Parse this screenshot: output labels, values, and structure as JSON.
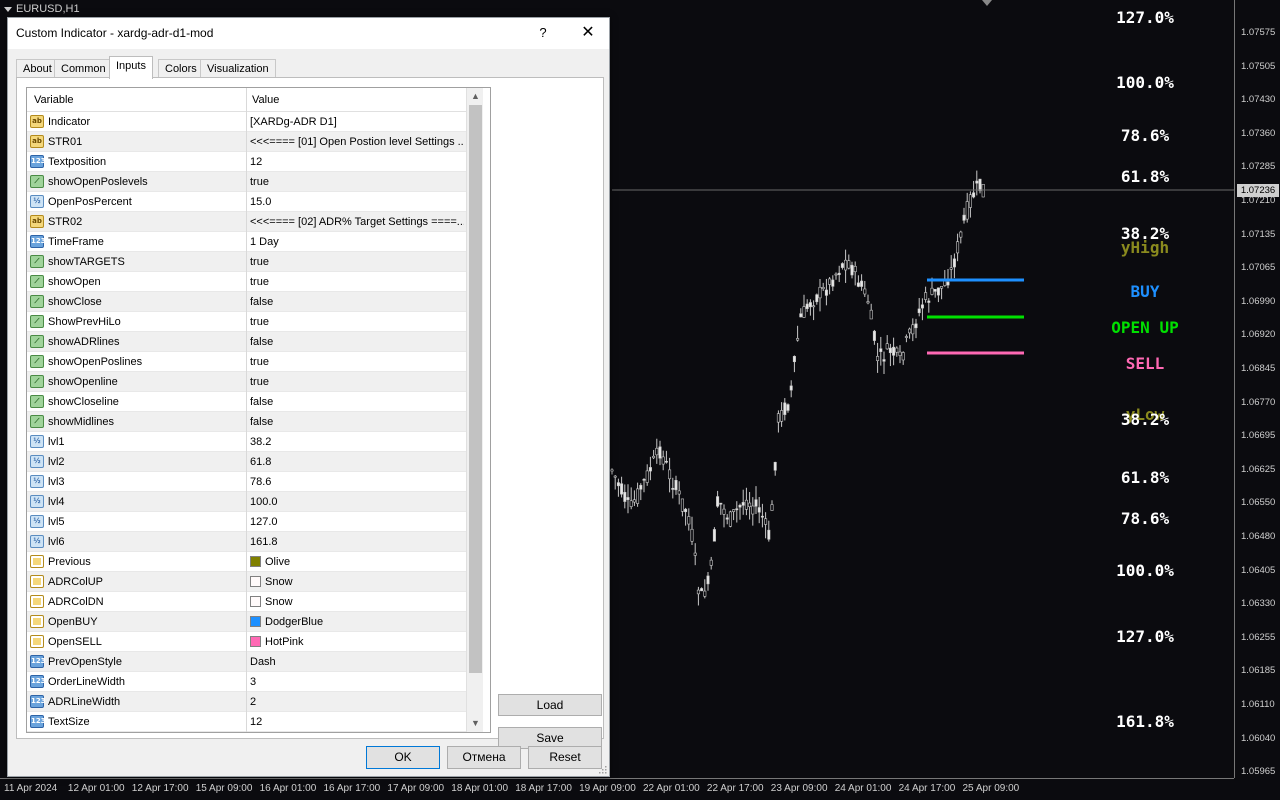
{
  "chart": {
    "symbol": "EURUSD,H1",
    "current_price": "1.07236",
    "price_ticks": [
      "1.07575",
      "1.07505",
      "1.07430",
      "1.07360",
      "1.07285",
      "1.07210",
      "1.07135",
      "1.07065",
      "1.06990",
      "1.06920",
      "1.06845",
      "1.06770",
      "1.06695",
      "1.06625",
      "1.06550",
      "1.06480",
      "1.06405",
      "1.06330",
      "1.06255",
      "1.06185",
      "1.06110",
      "1.06040",
      "1.05965"
    ],
    "time_ticks": [
      "11 Apr 2024",
      "12 Apr 01:00",
      "12 Apr 17:00",
      "15 Apr 09:00",
      "16 Apr 01:00",
      "16 Apr 17:00",
      "17 Apr 09:00",
      "18 Apr 01:00",
      "18 Apr 17:00",
      "19 Apr 09:00",
      "22 Apr 01:00",
      "22 Apr 17:00",
      "23 Apr 09:00",
      "24 Apr 01:00",
      "24 Apr 17:00",
      "25 Apr 09:00"
    ],
    "level_labels": [
      {
        "text": "127.0%",
        "color": "#ffffff"
      },
      {
        "text": "100.0%",
        "color": "#ffffff"
      },
      {
        "text": "78.6%",
        "color": "#ffffff"
      },
      {
        "text": "61.8%",
        "color": "#ffffff"
      },
      {
        "text": "38.2%",
        "color": "#ffffff"
      },
      {
        "text": "yHigh",
        "color": "#8a8a1e"
      },
      {
        "text": "BUY",
        "color": "#1e90ff"
      },
      {
        "text": "OPEN UP",
        "color": "#00e000"
      },
      {
        "text": "SELL",
        "color": "#ff69b4"
      },
      {
        "text": "yLow",
        "color": "#8a8a1e"
      },
      {
        "text": "38.2%",
        "color": "#ffffff"
      },
      {
        "text": "61.8%",
        "color": "#ffffff"
      },
      {
        "text": "78.6%",
        "color": "#ffffff"
      },
      {
        "text": "100.0%",
        "color": "#ffffff"
      },
      {
        "text": "127.0%",
        "color": "#ffffff"
      },
      {
        "text": "161.8%",
        "color": "#ffffff"
      }
    ],
    "colors": {
      "buy": "#1e90ff",
      "open": "#00e000",
      "sell": "#ff69b4",
      "candle": "#c8c8c8"
    }
  },
  "dialog": {
    "title": "Custom Indicator - xardg-adr-d1-mod",
    "help": "?",
    "close": "✕",
    "tabs": [
      "About",
      "Common",
      "Inputs",
      "Colors",
      "Visualization"
    ],
    "active_tab": "Inputs",
    "grid_headers": {
      "variable": "Variable",
      "value": "Value"
    },
    "rows": [
      {
        "icon": "ab",
        "var": "Indicator",
        "val": "[XARDg-ADR D1]"
      },
      {
        "icon": "ab",
        "var": "STR01",
        "val": "<<<==== [01] Open Postion level Settings ..."
      },
      {
        "icon": "n123",
        "var": "Textposition",
        "val": "12"
      },
      {
        "icon": "bool",
        "var": "showOpenPoslevels",
        "val": "true"
      },
      {
        "icon": "frac",
        "var": "OpenPosPercent",
        "val": "15.0"
      },
      {
        "icon": "ab",
        "var": "STR02",
        "val": "<<<==== [02] ADR% Target Settings ====..."
      },
      {
        "icon": "n123",
        "var": "TimeFrame",
        "val": "1 Day"
      },
      {
        "icon": "bool",
        "var": "showTARGETS",
        "val": "true"
      },
      {
        "icon": "bool",
        "var": "showOpen",
        "val": "true"
      },
      {
        "icon": "bool",
        "var": "showClose",
        "val": "false"
      },
      {
        "icon": "bool",
        "var": "ShowPrevHiLo",
        "val": "true"
      },
      {
        "icon": "bool",
        "var": "showADRlines",
        "val": "false"
      },
      {
        "icon": "bool",
        "var": "showOpenPoslines",
        "val": "true"
      },
      {
        "icon": "bool",
        "var": "showOpenline",
        "val": "true"
      },
      {
        "icon": "bool",
        "var": "showCloseline",
        "val": "false"
      },
      {
        "icon": "bool",
        "var": "showMidlines",
        "val": "false"
      },
      {
        "icon": "frac",
        "var": "lvl1",
        "val": "38.2"
      },
      {
        "icon": "frac",
        "var": "lvl2",
        "val": "61.8"
      },
      {
        "icon": "frac",
        "var": "lvl3",
        "val": "78.6"
      },
      {
        "icon": "frac",
        "var": "lvl4",
        "val": "100.0"
      },
      {
        "icon": "frac",
        "var": "lvl5",
        "val": "127.0"
      },
      {
        "icon": "frac",
        "var": "lvl6",
        "val": "161.8"
      },
      {
        "icon": "color",
        "var": "Previous",
        "val": "Olive",
        "swatch": "#808000"
      },
      {
        "icon": "color",
        "var": "ADRColUP",
        "val": "Snow",
        "swatch": "#fffafa"
      },
      {
        "icon": "color",
        "var": "ADRColDN",
        "val": "Snow",
        "swatch": "#fffafa"
      },
      {
        "icon": "color",
        "var": "OpenBUY",
        "val": "DodgerBlue",
        "swatch": "#1e90ff"
      },
      {
        "icon": "color",
        "var": "OpenSELL",
        "val": "HotPink",
        "swatch": "#ff69b4"
      },
      {
        "icon": "n123",
        "var": "PrevOpenStyle",
        "val": "Dash"
      },
      {
        "icon": "n123",
        "var": "OrderLineWidth",
        "val": "3"
      },
      {
        "icon": "n123",
        "var": "ADRLineWidth",
        "val": "2"
      },
      {
        "icon": "n123",
        "var": "TextSize",
        "val": "12"
      }
    ],
    "buttons": {
      "load": "Load",
      "save": "Save",
      "ok": "OK",
      "cancel": "Отмена",
      "reset": "Reset"
    }
  }
}
